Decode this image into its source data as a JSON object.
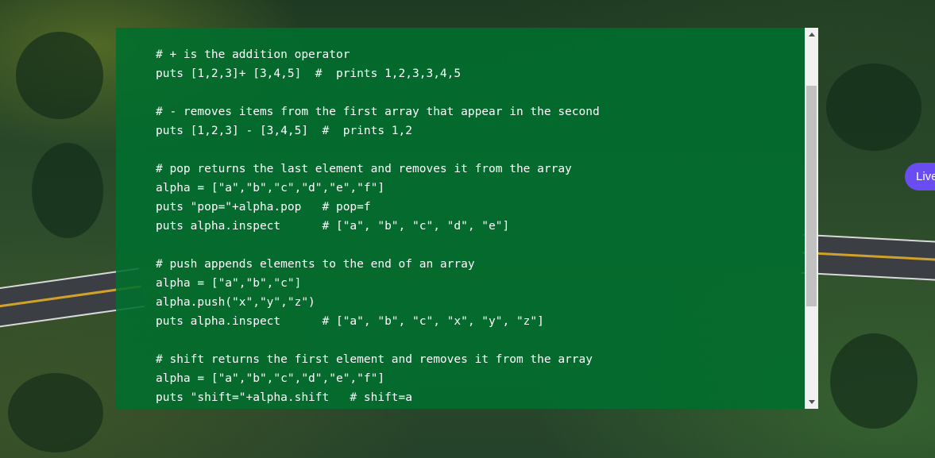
{
  "code_panel": {
    "lines": [
      "# + is the addition operator",
      "puts [1,2,3]+ [3,4,5]  #  prints 1,2,3,3,4,5",
      "",
      "# - removes items from the first array that appear in the second",
      "puts [1,2,3] - [3,4,5]  #  prints 1,2",
      "",
      "# pop returns the last element and removes it from the array",
      "alpha = [\"a\",\"b\",\"c\",\"d\",\"e\",\"f\"]",
      "puts \"pop=\"+alpha.pop   # pop=f",
      "puts alpha.inspect      # [\"a\", \"b\", \"c\", \"d\", \"e\"]",
      "",
      "# push appends elements to the end of an array",
      "alpha = [\"a\",\"b\",\"c\"]",
      "alpha.push(\"x\",\"y\",\"z\")",
      "puts alpha.inspect      # [\"a\", \"b\", \"c\", \"x\", \"y\", \"z\"]",
      "",
      "# shift returns the first element and removes it from the array",
      "alpha = [\"a\",\"b\",\"c\",\"d\",\"e\",\"f\"]",
      "puts \"shift=\"+alpha.shift   # shift=a"
    ]
  },
  "live_button": {
    "label": "Live"
  },
  "colors": {
    "panel_background": "#006e2d",
    "live_button": "#6a4df0",
    "scrollbar_track": "#f1f1f1",
    "scrollbar_thumb": "#c1c1c1"
  }
}
